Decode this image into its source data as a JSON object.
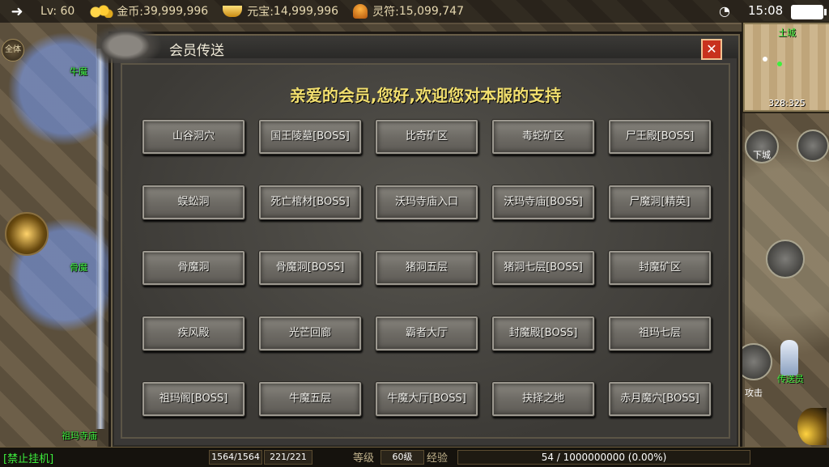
{
  "status_bar": {
    "level": "Lv: 60",
    "gold_label": "金币:",
    "gold_value": "39,999,996",
    "ingot_label": "元宝:",
    "ingot_value": "14,999,996",
    "talisman_label": "灵符:",
    "talisman_value": "15,099,747",
    "time": "15:08",
    "icons": [
      "back-arrow-icon",
      "coin-icon",
      "ingot-icon",
      "talisman-icon",
      "wifi-icon",
      "battery-icon"
    ]
  },
  "minimap": {
    "title": "土城",
    "coords": "328:325"
  },
  "world": {
    "zone_labels": [
      "牛魔",
      "骨魔",
      "祖玛寺庙"
    ],
    "left_button": "全体",
    "skill_buttons": [
      "下城",
      "攻击"
    ],
    "npc_name": "传送员"
  },
  "dialog": {
    "title": "会员传送",
    "close_label": "✕",
    "greeting": "亲爱的会员,您好,欢迎您对本服的支持",
    "rows": [
      [
        "山谷洞穴",
        "国王陵墓[BOSS]",
        "比奇矿区",
        "毒蛇矿区",
        "尸王殿[BOSS]"
      ],
      [
        "蜈蚣洞",
        "死亡棺材[BOSS]",
        "沃玛寺庙入口",
        "沃玛寺庙[BOSS]",
        "尸魔洞[精英]"
      ],
      [
        "骨魔洞",
        "骨魔洞[BOSS]",
        "猪洞五层",
        "猪洞七层[BOSS]",
        "封魔矿区"
      ],
      [
        "疾风殿",
        "光芒回廊",
        "霸者大厅",
        "封魔殿[BOSS]",
        "祖玛七层"
      ],
      [
        "祖玛阁[BOSS]",
        "牛魔五层",
        "牛魔大厅[BOSS]",
        "抉择之地",
        "赤月魔穴[BOSS]"
      ]
    ]
  },
  "bottom_bar": {
    "afk": "[禁止挂机]",
    "hp": "1564/1564",
    "mp": "221/221",
    "level_label": "等级",
    "level_value": "60级",
    "exp_label": "经验",
    "exp_value": "54 / 1000000000 (0.00%)"
  },
  "colors": {
    "accent_green": "#3df03d",
    "greeting_gold": "#f2df6e",
    "close_red": "#c8321e"
  }
}
